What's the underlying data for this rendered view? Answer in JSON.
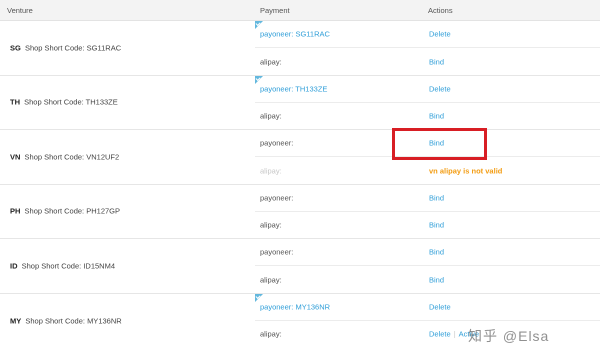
{
  "headers": {
    "venture": "Venture",
    "payment": "Payment",
    "actions": "Actions"
  },
  "label_prefix": "Shop Short Code:",
  "rows": [
    {
      "code": "SG",
      "short_code": "SG11RAC",
      "top": {
        "payment": "payoneer: SG11RAC",
        "action": "Delete"
      },
      "bottom": {
        "payment": "alipay:",
        "action": "Bind"
      }
    },
    {
      "code": "TH",
      "short_code": "TH133ZE",
      "top": {
        "payment": "payoneer: TH133ZE",
        "action": "Delete"
      },
      "bottom": {
        "payment": "alipay:",
        "action": "Bind"
      }
    },
    {
      "code": "VN",
      "short_code": "VN12UF2",
      "top": {
        "payment": "payoneer:",
        "action": "Bind"
      },
      "bottom": {
        "payment": "alipay:",
        "warning": "vn alipay is not valid"
      }
    },
    {
      "code": "PH",
      "short_code": "PH127GP",
      "top": {
        "payment": "payoneer:",
        "action": "Bind"
      },
      "bottom": {
        "payment": "alipay:",
        "action": "Bind"
      }
    },
    {
      "code": "ID",
      "short_code": "ID15NM4",
      "top": {
        "payment": "payoneer:",
        "action": "Bind"
      },
      "bottom": {
        "payment": "alipay:",
        "action": "Bind"
      }
    },
    {
      "code": "MY",
      "short_code": "MY136NR",
      "top": {
        "payment": "payoneer: MY136NR",
        "action": "Delete"
      },
      "bottom": {
        "payment": "alipay:",
        "action": "Delete",
        "action2": "Active"
      }
    }
  ],
  "watermark": "知乎 @Elsa",
  "colors": {
    "link": "#2f9ed8",
    "warning": "#f39c12",
    "highlight": "#d81e24",
    "header_bg": "#f3f3f3"
  }
}
